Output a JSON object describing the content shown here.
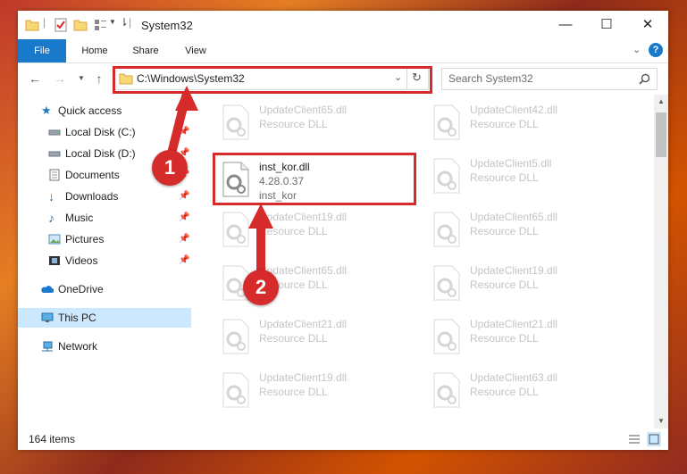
{
  "window": {
    "title": "System32",
    "buttons": {
      "minimize": "—",
      "maximize": "☐",
      "close": "✕"
    }
  },
  "ribbon": {
    "tabs": [
      "File",
      "Home",
      "Share",
      "View"
    ]
  },
  "navigation": {
    "address": "C:\\Windows\\System32",
    "search_placeholder": "Search System32"
  },
  "sidebar": {
    "items": [
      {
        "label": "Quick access",
        "icon": "star-icon",
        "pinned": false
      },
      {
        "label": "Local Disk (C:)",
        "icon": "drive-icon",
        "pinned": true
      },
      {
        "label": "Local Disk (D:)",
        "icon": "drive-icon",
        "pinned": true
      },
      {
        "label": "Documents",
        "icon": "documents-icon",
        "pinned": true
      },
      {
        "label": "Downloads",
        "icon": "download-icon",
        "pinned": true
      },
      {
        "label": "Music",
        "icon": "music-icon",
        "pinned": true
      },
      {
        "label": "Pictures",
        "icon": "pictures-icon",
        "pinned": true
      },
      {
        "label": "Videos",
        "icon": "videos-icon",
        "pinned": true
      },
      {
        "label": "OneDrive",
        "icon": "cloud-icon",
        "pinned": false
      },
      {
        "label": "This PC",
        "icon": "computer-icon",
        "pinned": false,
        "selected": true
      },
      {
        "label": "Network",
        "icon": "network-icon",
        "pinned": false
      }
    ]
  },
  "files": {
    "left_column": [
      {
        "name": "UpdateClient65.dll",
        "desc": "Resource DLL"
      },
      {
        "name": "inst_kor.dll",
        "desc": "4.28.0.37",
        "desc2": "inst_kor",
        "highlighted": true
      },
      {
        "name": "UpdateClient19.dll",
        "desc": "Resource DLL"
      },
      {
        "name": "UpdateClient65.dll",
        "desc": "Resource DLL"
      },
      {
        "name": "UpdateClient21.dll",
        "desc": "Resource DLL"
      },
      {
        "name": "UpdateClient19.dll",
        "desc": "Resource DLL"
      }
    ],
    "right_column": [
      {
        "name": "UpdateClient42.dll",
        "desc": "Resource DLL"
      },
      {
        "name": "UpdateClient5.dll",
        "desc": "Resource DLL"
      },
      {
        "name": "UpdateClient65.dll",
        "desc": "Resource DLL"
      },
      {
        "name": "UpdateClient19.dll",
        "desc": "Resource DLL"
      },
      {
        "name": "UpdateClient21.dll",
        "desc": "Resource DLL"
      },
      {
        "name": "UpdateClient63.dll",
        "desc": "Resource DLL"
      }
    ]
  },
  "status": {
    "item_count": "164 items"
  },
  "callouts": [
    "1",
    "2"
  ],
  "colors": {
    "accent": "#1979ca",
    "highlight": "#d62b2b",
    "selected_bg": "#cce8ff"
  }
}
